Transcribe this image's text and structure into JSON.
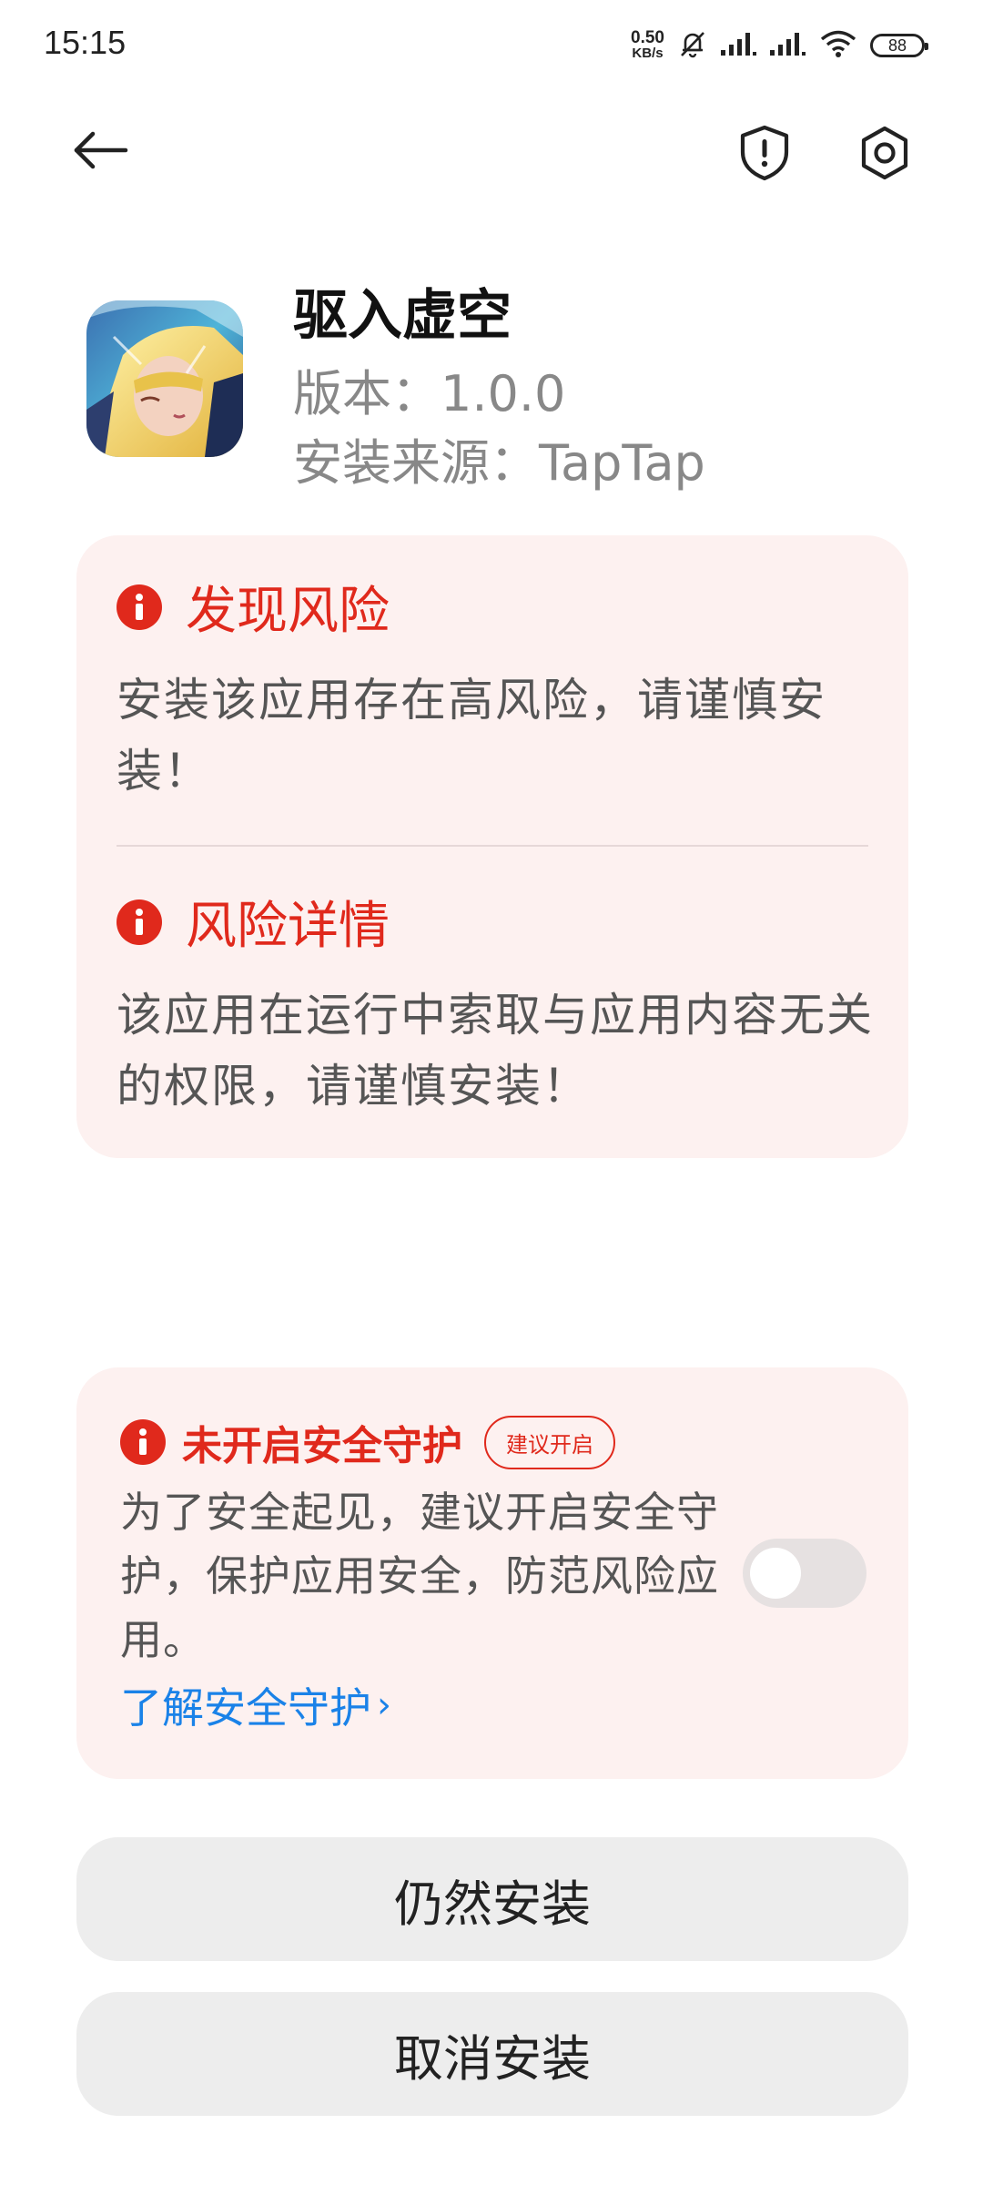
{
  "status_bar": {
    "time": "15:15",
    "net_speed_value": "0.50",
    "net_speed_unit": "KB/s",
    "battery": "88"
  },
  "header": {
    "back_icon": "back-arrow-icon",
    "shield_icon": "shield-icon",
    "settings_icon": "gear-icon"
  },
  "app": {
    "name": "驱入虚空",
    "version": "版本：1.0.0",
    "source": "安装来源：TapTap"
  },
  "risk": {
    "found_title": "发现风险",
    "found_text": "安装该应用存在高风险，请谨慎安装！",
    "detail_title": "风险详情",
    "detail_text": "该应用在运行中索取与应用内容无关的权限，请谨慎安装！"
  },
  "protection": {
    "title": "未开启安全守护",
    "badge": "建议开启",
    "text": "为了安全起见，建议开启安全守护，保护应用安全，防范风险应用。",
    "link": "了解安全守护",
    "toggle_on": false
  },
  "actions": {
    "install": "仍然安装",
    "cancel": "取消安装"
  },
  "colors": {
    "danger": "#e0291c",
    "card_bg": "#fdf1f0",
    "link": "#1a82e8",
    "button_bg": "#ededed"
  }
}
